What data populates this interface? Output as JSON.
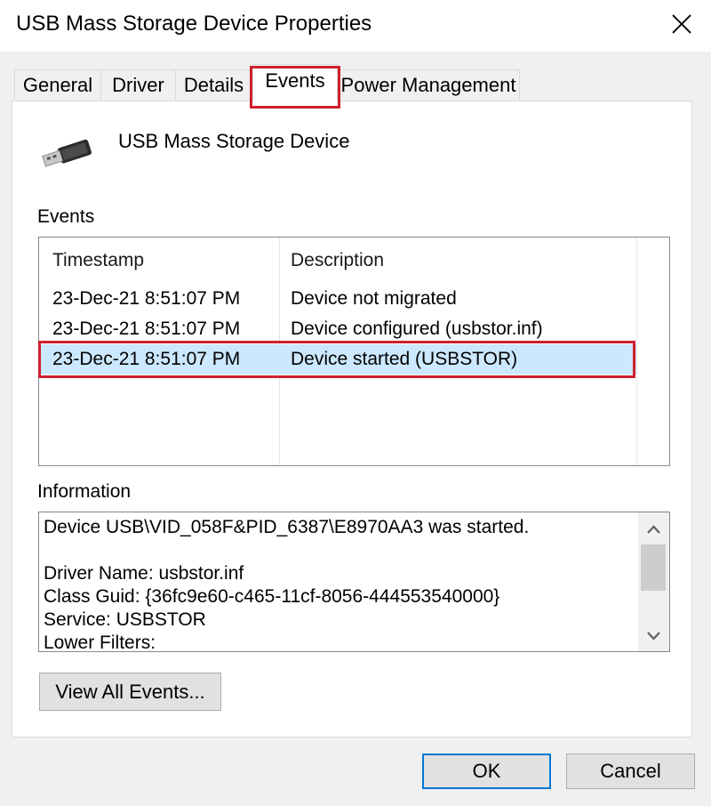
{
  "window": {
    "title": "USB Mass Storage Device Properties"
  },
  "tabs": [
    {
      "label": "General"
    },
    {
      "label": "Driver"
    },
    {
      "label": "Details"
    },
    {
      "label": "Events"
    },
    {
      "label": "Power Management"
    }
  ],
  "active_tab": "Events",
  "device": {
    "name": "USB Mass Storage Device",
    "icon": "usb-plug-icon"
  },
  "events": {
    "label": "Events",
    "columns": [
      "Timestamp",
      "Description"
    ],
    "rows": [
      {
        "timestamp": "23-Dec-21 8:51:07 PM",
        "description": "Device not migrated"
      },
      {
        "timestamp": "23-Dec-21 8:51:07 PM",
        "description": "Device configured (usbstor.inf)"
      },
      {
        "timestamp": "23-Dec-21 8:51:07 PM",
        "description": "Device started (USBSTOR)"
      }
    ],
    "selected_index": 2
  },
  "information": {
    "label": "Information",
    "text": "Device USB\\VID_058F&PID_6387\\E8970AA3 was started.\n\nDriver Name: usbstor.inf\nClass Guid: {36fc9e60-c465-11cf-8056-444553540000}\nService: USBSTOR\nLower Filters:"
  },
  "buttons": {
    "view_all": "View All Events...",
    "ok": "OK",
    "cancel": "Cancel"
  },
  "colors": {
    "highlight": "#d0202e",
    "selection": "#cce8ff",
    "focus_border": "#0078d7"
  }
}
